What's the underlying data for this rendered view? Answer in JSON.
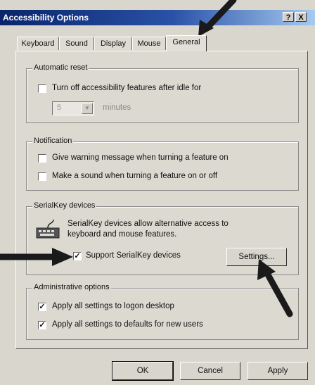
{
  "window": {
    "title": "Accessibility Options",
    "help_glyph": "?",
    "close_glyph": "X"
  },
  "tabs": [
    {
      "label": "Keyboard"
    },
    {
      "label": "Sound"
    },
    {
      "label": "Display"
    },
    {
      "label": "Mouse"
    },
    {
      "label": "General",
      "active": true
    }
  ],
  "automatic_reset": {
    "legend": "Automatic reset",
    "checkbox_label": "Turn off accessibility features after idle for",
    "checked": false,
    "minutes_value": "5",
    "minutes_label": "minutes"
  },
  "notification": {
    "legend": "Notification",
    "items": [
      {
        "label": "Give warning message when turning a feature on",
        "checked": false
      },
      {
        "label": "Make a sound when turning a feature on or off",
        "checked": false
      }
    ]
  },
  "serialkey": {
    "legend": "SerialKey devices",
    "description_line1": "SerialKey devices allow alternative access to",
    "description_line2": "keyboard and mouse features.",
    "checkbox_label": "Support SerialKey devices",
    "checked": true,
    "settings_button": "Settings..."
  },
  "administrative": {
    "legend": "Administrative options",
    "items": [
      {
        "label": "Apply all settings to logon desktop",
        "checked": true
      },
      {
        "label": "Apply all settings to defaults for new users",
        "checked": true
      }
    ]
  },
  "footer": {
    "ok": "OK",
    "cancel": "Cancel",
    "apply": "Apply"
  },
  "check_glyph": "✓",
  "colors": {
    "title_start": "#0a246a",
    "title_end": "#a6caf0",
    "arrow": "#1a1a1a"
  }
}
